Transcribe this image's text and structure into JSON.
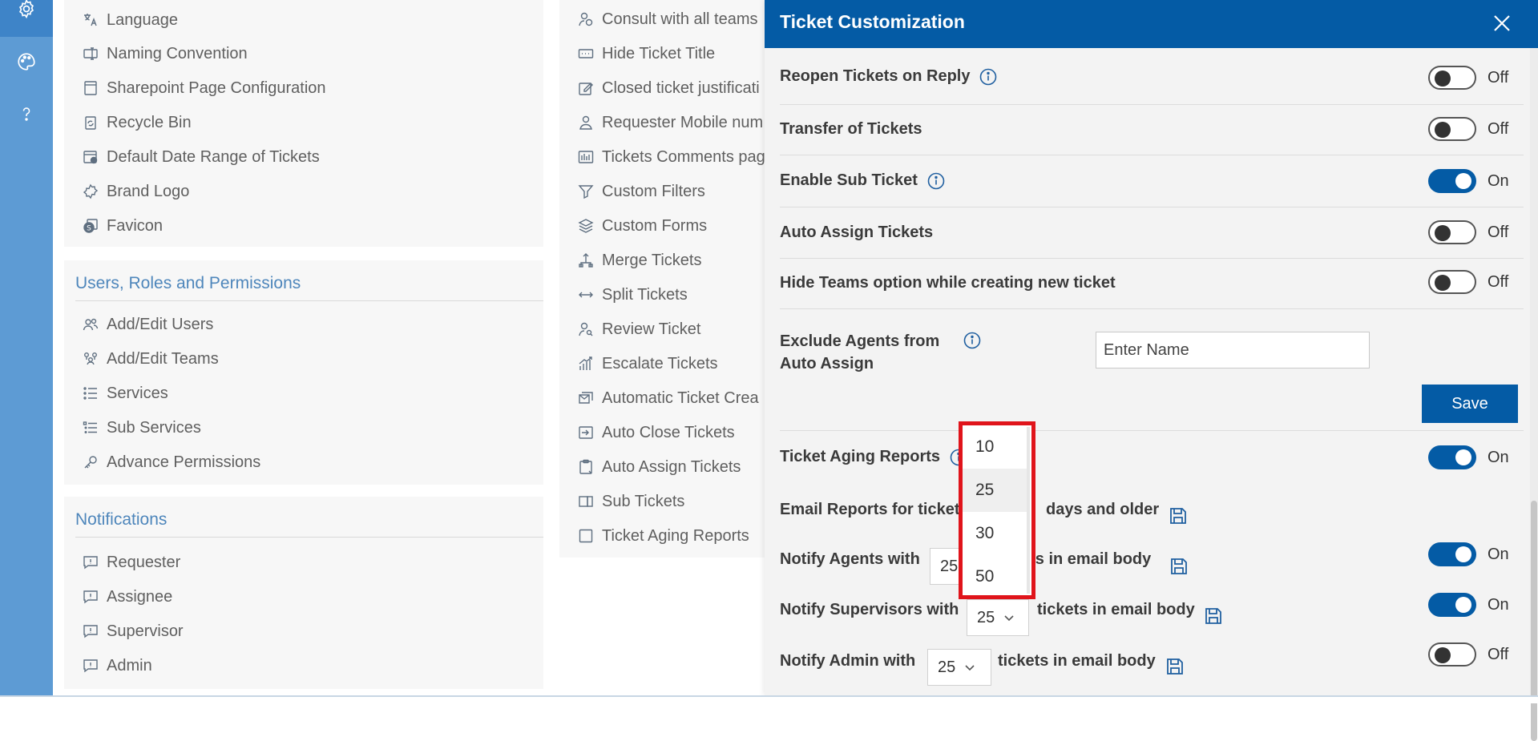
{
  "rail": {
    "icons": [
      "gear-icon",
      "palette-icon",
      "help-icon"
    ]
  },
  "general_panel": {
    "items": [
      {
        "label": "Language",
        "icon": "language-icon"
      },
      {
        "label": "Naming Convention",
        "icon": "naming-icon"
      },
      {
        "label": "Sharepoint Page Configuration",
        "icon": "page-icon"
      },
      {
        "label": "Recycle Bin",
        "icon": "recycle-bin-icon"
      },
      {
        "label": "Default Date Range of Tickets",
        "icon": "calendar-icon"
      },
      {
        "label": "Brand Logo",
        "icon": "brand-icon"
      },
      {
        "label": "Favicon",
        "icon": "favicon-icon"
      }
    ]
  },
  "users_panel": {
    "title": "Users, Roles and Permissions",
    "items": [
      {
        "label": "Add/Edit Users",
        "icon": "users-icon"
      },
      {
        "label": "Add/Edit Teams",
        "icon": "teams-icon"
      },
      {
        "label": "Services",
        "icon": "list-icon"
      },
      {
        "label": "Sub Services",
        "icon": "sublist-icon"
      },
      {
        "label": "Advance Permissions",
        "icon": "key-icon"
      }
    ]
  },
  "notifications_panel": {
    "title": "Notifications",
    "items": [
      {
        "label": "Requester",
        "icon": "comment-icon"
      },
      {
        "label": "Assignee",
        "icon": "comment-icon"
      },
      {
        "label": "Supervisor",
        "icon": "comment-icon"
      },
      {
        "label": "Admin",
        "icon": "comment-icon"
      }
    ]
  },
  "tickets_panel": {
    "items": [
      {
        "label": "Consult with all teams",
        "icon": "consult-icon"
      },
      {
        "label": "Hide Ticket Title",
        "icon": "hide-title-icon"
      },
      {
        "label": "Closed ticket justificati",
        "icon": "edit-icon"
      },
      {
        "label": "Requester Mobile num",
        "icon": "mobile-user-icon"
      },
      {
        "label": "Tickets Comments pag",
        "icon": "comments-page-icon"
      },
      {
        "label": "Custom Filters",
        "icon": "filter-icon"
      },
      {
        "label": "Custom Forms",
        "icon": "layers-icon"
      },
      {
        "label": "Merge Tickets",
        "icon": "merge-icon"
      },
      {
        "label": "Split Tickets",
        "icon": "split-icon"
      },
      {
        "label": "Review Ticket",
        "icon": "review-icon"
      },
      {
        "label": "Escalate Tickets",
        "icon": "escalate-icon"
      },
      {
        "label": "Automatic Ticket Crea",
        "icon": "mail-icon"
      },
      {
        "label": "Auto Close Tickets",
        "icon": "auto-close-icon"
      },
      {
        "label": "Auto Assign Tickets",
        "icon": "clipboard-icon"
      },
      {
        "label": "Sub Tickets",
        "icon": "sub-tickets-icon"
      },
      {
        "label": "Ticket Aging Reports",
        "icon": "checkbox-icon"
      }
    ]
  },
  "drawer": {
    "title": "Ticket Customization",
    "rows": [
      {
        "label": "Reopen Tickets on Reply",
        "info": true,
        "state": "Off",
        "on": false
      },
      {
        "label": "Transfer of Tickets",
        "info": false,
        "state": "Off",
        "on": false
      },
      {
        "label": "Enable Sub Ticket",
        "info": true,
        "state": "On",
        "on": true
      },
      {
        "label": "Auto Assign Tickets",
        "info": false,
        "state": "Off",
        "on": false
      },
      {
        "label": "Hide Teams option while creating new ticket",
        "info": false,
        "state": "Off",
        "on": false
      }
    ],
    "exclude": {
      "label_line1": "Exclude Agents from",
      "label_line2": "Auto Assign",
      "placeholder": "Enter Name",
      "save_label": "Save"
    },
    "aging": {
      "label": "Ticket Aging Reports",
      "state": "On",
      "on": true,
      "email_prefix": "Email Reports for tickets",
      "email_suffix": "days and older",
      "agents_prefix": "Notify Agents with",
      "agents_value": "25",
      "agents_suffix": "ets in email body",
      "agents_state": "On",
      "supervisors_prefix": "Notify Supervisors with",
      "supervisors_value": "25",
      "supervisors_suffix": "tickets in email body",
      "supervisors_state": "On",
      "admin_prefix": "Notify Admin with",
      "admin_value": "25",
      "admin_suffix": "tickets in email body",
      "admin_state": "Off"
    },
    "dropdown": {
      "options": [
        "10",
        "25",
        "30",
        "50"
      ],
      "selected": "25",
      "highlight_color": "#e0141b"
    }
  },
  "colors": {
    "primary": "#045ba5",
    "rail": "#5d9bd4",
    "section_title": "#4e86bb"
  }
}
